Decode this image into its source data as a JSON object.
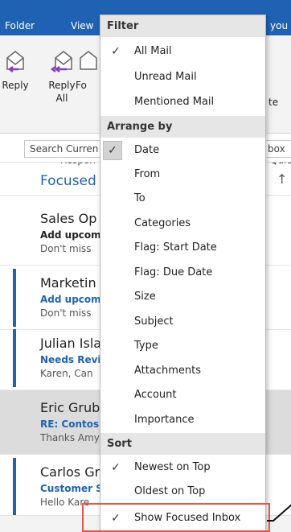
{
  "menu_tabs": [
    "Folder",
    "View",
    "you"
  ],
  "ribbon": {
    "reply": "Reply",
    "reply_all": "Reply\nAll",
    "forward": "Fo",
    "group_label": "Respon",
    "right_te": "te",
    "right_quic": "Quic"
  },
  "search": {
    "placeholder": "Search Curren",
    "right": "box"
  },
  "focused_tab": "Focused",
  "sort_arrow": "↑",
  "mails": [
    {
      "from": "Sales Op",
      "subject": "Add upcom",
      "preview": "Don't miss",
      "unread": false,
      "blue": false
    },
    {
      "from": "Marketin",
      "subject": "Add upcom",
      "preview": "Don't miss",
      "unread": true,
      "blue": true
    },
    {
      "from": "Julian Isla",
      "subject": "Needs Revi",
      "preview": "Karen, Can",
      "unread": true,
      "blue": true
    },
    {
      "from": "Eric Grub",
      "subject": "RE: Contos",
      "preview": "Thanks Amy",
      "unread": false,
      "blue": true
    },
    {
      "from": "Carlos Gr",
      "subject": "Customer S",
      "preview": "Hello Kare",
      "unread": true,
      "blue": true
    }
  ],
  "dropdown": {
    "filter_header": "Filter",
    "filter_items": [
      {
        "label": "All Mail",
        "checked": true
      },
      {
        "label": "Unread Mail",
        "checked": false
      },
      {
        "label": "Mentioned Mail",
        "checked": false
      }
    ],
    "arrange_header": "Arrange by",
    "arrange_items": [
      {
        "label": "Date",
        "checked": true
      },
      {
        "label": "From",
        "checked": false
      },
      {
        "label": "To",
        "checked": false
      },
      {
        "label": "Categories",
        "checked": false
      },
      {
        "label": "Flag: Start Date",
        "checked": false
      },
      {
        "label": "Flag: Due Date",
        "checked": false
      },
      {
        "label": "Size",
        "checked": false
      },
      {
        "label": "Subject",
        "checked": false
      },
      {
        "label": "Type",
        "checked": false
      },
      {
        "label": "Attachments",
        "checked": false
      },
      {
        "label": "Account",
        "checked": false
      },
      {
        "label": "Importance",
        "checked": false
      }
    ],
    "sort_header": "Sort",
    "sort_items": [
      {
        "label": "Newest on Top",
        "checked": true
      },
      {
        "label": "Oldest on Top",
        "checked": false
      }
    ],
    "focused_toggle": {
      "label": "Show Focused Inbox",
      "checked": true
    }
  },
  "colors": {
    "accent": "#1f62b4",
    "highlight": "#e2574a",
    "menu_header_bg": "#e6e6e6"
  }
}
